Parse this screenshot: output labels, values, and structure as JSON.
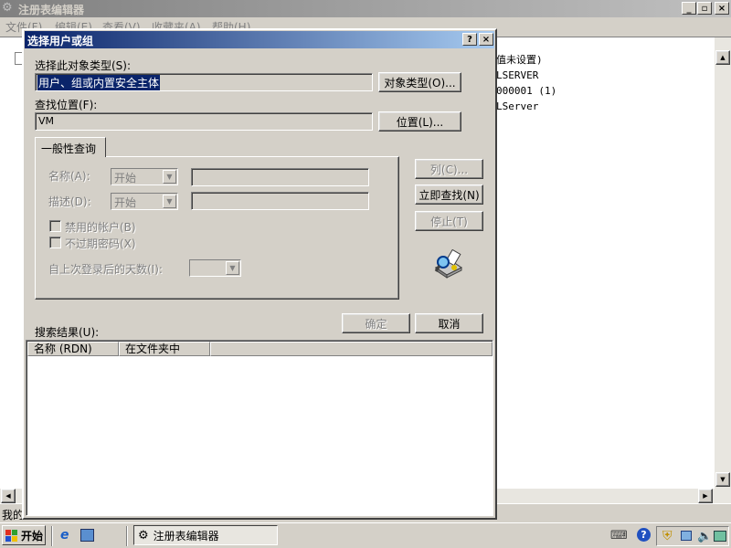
{
  "bg_window": {
    "title": "注册表编辑器",
    "menu": [
      "文件(F)",
      "编辑(E)",
      "查看(V)",
      "收藏夹(A)",
      "帮助(H)"
    ],
    "right_lines": [
      "值未设置)",
      "LSERVER",
      "000001 (1)",
      "LServer"
    ],
    "status_text": "我的"
  },
  "dialog": {
    "title": "选择用户或组",
    "help_btn": "?",
    "close_btn": "×",
    "object_type_label": "选择此对象类型(S):",
    "object_type_value": "用户、组或内置安全主体",
    "object_type_button": "对象类型(O)...",
    "location_label": "查找位置(F):",
    "location_value": "VM",
    "location_button": "位置(L)...",
    "tab_label": "一般性查询",
    "name_label": "名称(A):",
    "name_combo": "开始",
    "desc_label": "描述(D):",
    "desc_combo": "开始",
    "disabled_accounts": "禁用的帐户(B)",
    "no_expire_pwd": "不过期密码(X)",
    "days_since_login": "自上次登录后的天数(I):",
    "columns_button": "列(C)...",
    "find_now_button": "立即查找(N)",
    "stop_button": "停止(T)",
    "ok_button": "确定",
    "cancel_button": "取消",
    "results_label": "搜索结果(U):",
    "results_columns": [
      "名称 (RDN)",
      "在文件夹中"
    ]
  },
  "taskbar": {
    "start_label": "开始",
    "task_label": "注册表编辑器"
  },
  "colors": {
    "titlebar_start": "#0a246a",
    "titlebar_end": "#a6caf0",
    "inactive_title": "#808080",
    "face": "#d4d0c8"
  }
}
